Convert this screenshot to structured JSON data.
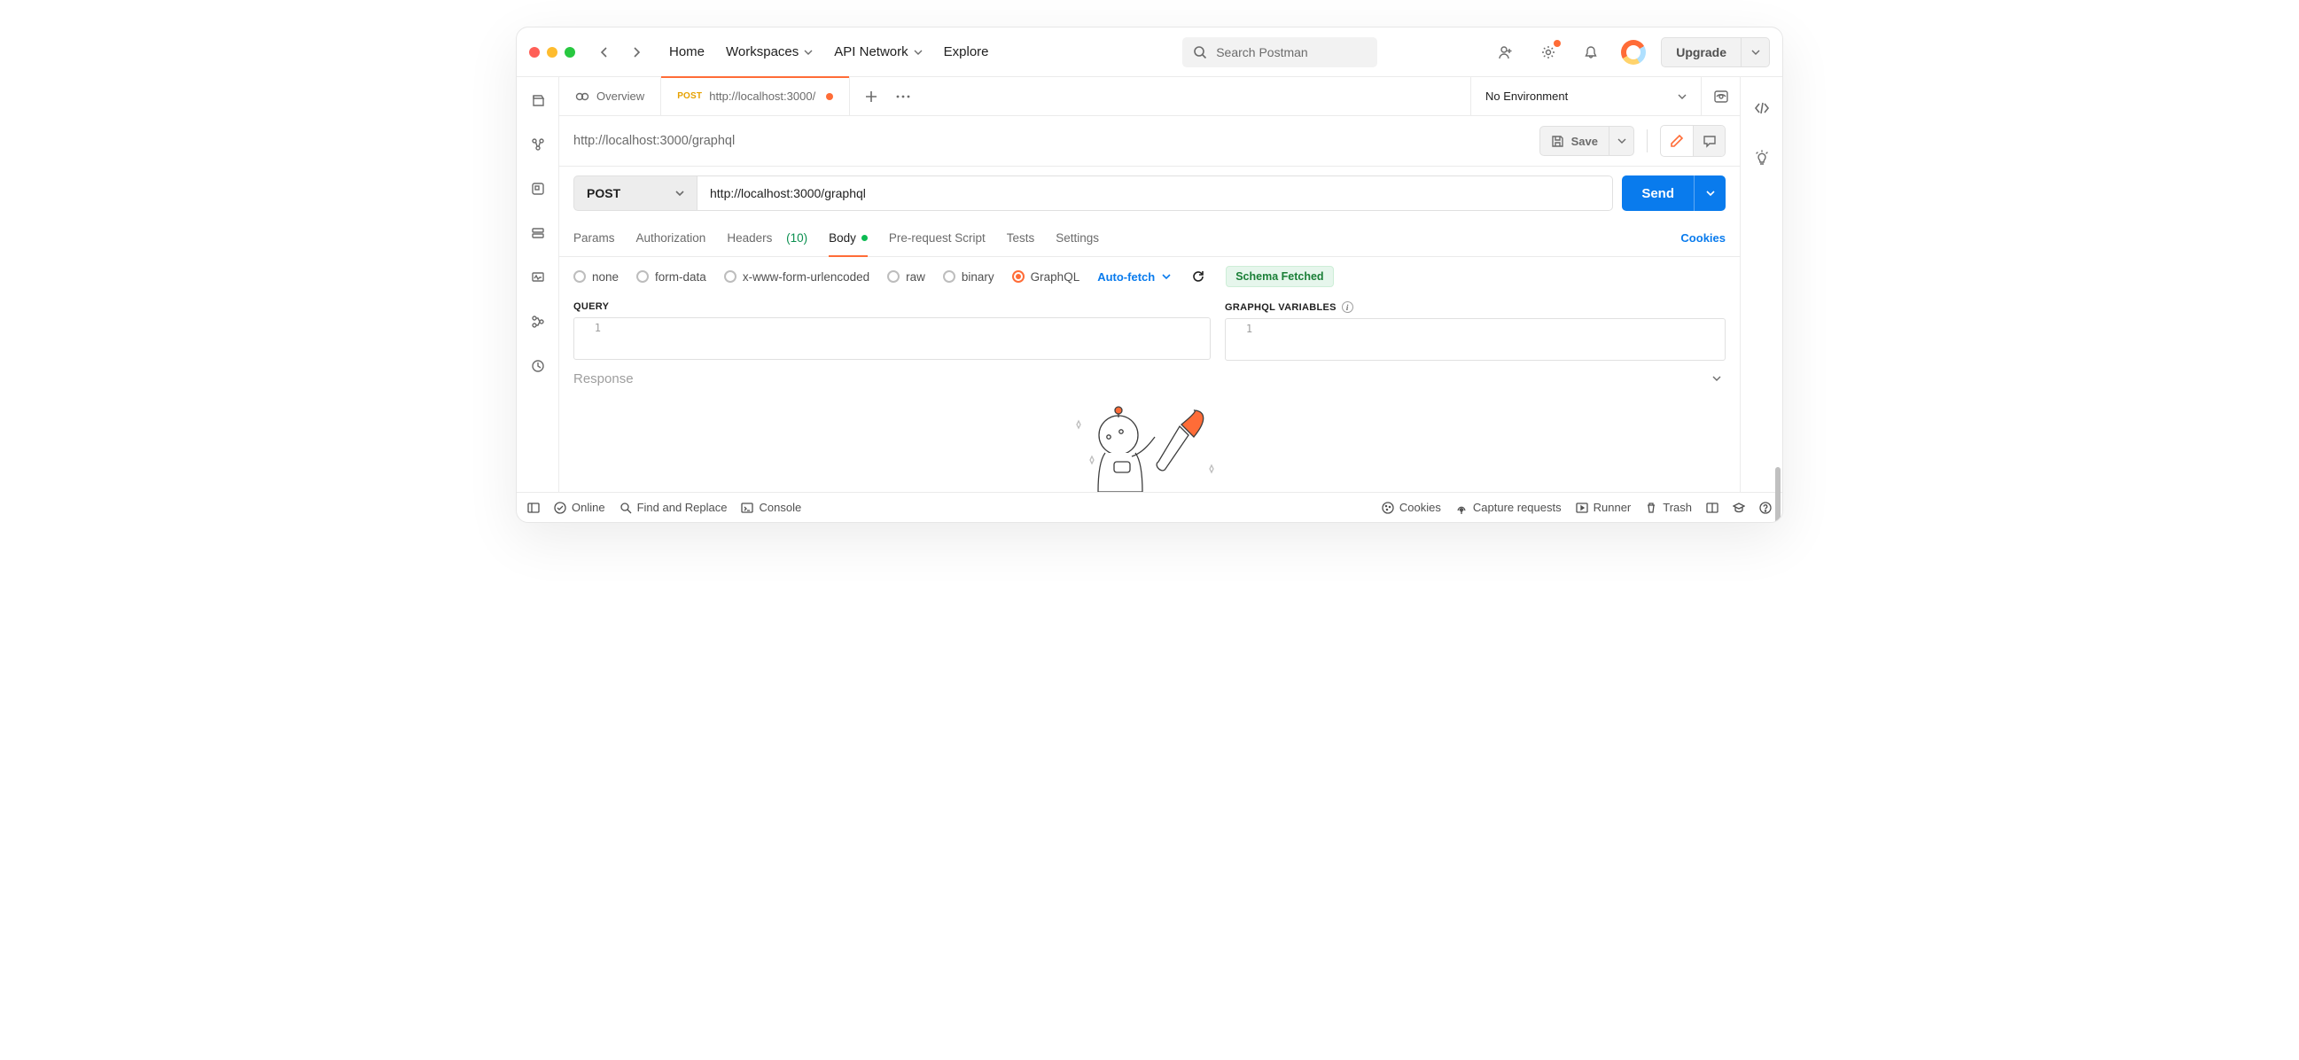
{
  "header": {
    "nav": {
      "home": "Home",
      "workspaces": "Workspaces",
      "api_network": "API Network",
      "explore": "Explore"
    },
    "search_placeholder": "Search Postman",
    "upgrade": "Upgrade"
  },
  "tabs": {
    "overview": "Overview",
    "active": {
      "method": "POST",
      "title": "http://localhost:3000/"
    }
  },
  "environment": {
    "selected": "No Environment"
  },
  "request": {
    "title": "http://localhost:3000/graphql",
    "save": "Save",
    "method": "POST",
    "url": "http://localhost:3000/graphql",
    "send": "Send"
  },
  "req_tabs": {
    "params": "Params",
    "authorization": "Authorization",
    "headers": "Headers",
    "headers_count": "(10)",
    "body": "Body",
    "prerequest": "Pre-request Script",
    "tests": "Tests",
    "settings": "Settings",
    "cookies": "Cookies"
  },
  "body_types": {
    "none": "none",
    "formdata": "form-data",
    "xwww": "x-www-form-urlencoded",
    "raw": "raw",
    "binary": "binary",
    "graphql": "GraphQL",
    "autofetch": "Auto-fetch",
    "schema_badge": "Schema Fetched"
  },
  "editors": {
    "query_label": "QUERY",
    "vars_label": "GRAPHQL VARIABLES",
    "line1": "1"
  },
  "response": {
    "label": "Response"
  },
  "statusbar": {
    "online": "Online",
    "find": "Find and Replace",
    "console": "Console",
    "cookies": "Cookies",
    "capture": "Capture requests",
    "runner": "Runner",
    "trash": "Trash"
  }
}
